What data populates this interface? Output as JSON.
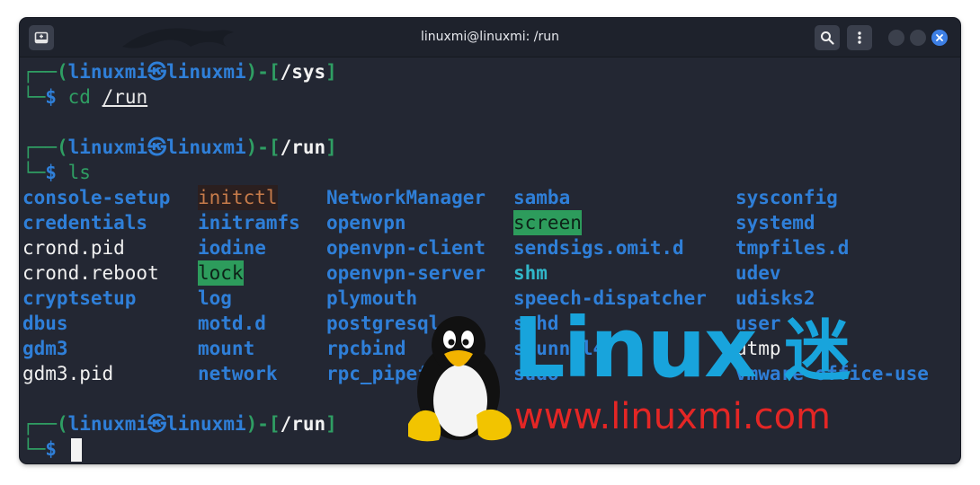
{
  "window": {
    "title": "linuxmi@linuxmi: /run",
    "colors": {
      "background": "#232733",
      "titlebar": "#1e222c",
      "close": "#3d7fe4"
    },
    "icons": [
      "new-tab-icon",
      "search-icon",
      "kebab-menu-icon",
      "minimize-icon",
      "maximize-icon",
      "close-icon"
    ]
  },
  "terminal": {
    "prompts": [
      {
        "corner": "┌──",
        "open": "(",
        "user": "linuxmi",
        "at": "㉿",
        "host": "linuxmi",
        "mid": ")-[",
        "path": "/sys",
        "close": "]",
        "bottom": "└─",
        "dollar": "$",
        "cmd": "cd",
        "arg": "/run"
      },
      {
        "corner": "┌──",
        "open": "(",
        "user": "linuxmi",
        "at": "㉿",
        "host": "linuxmi",
        "mid": ")-[",
        "path": "/run",
        "close": "]",
        "bottom": "└─",
        "dollar": "$",
        "cmd": "ls",
        "arg": ""
      },
      {
        "corner": "┌──",
        "open": "(",
        "user": "linuxmi",
        "at": "㉿",
        "host": "linuxmi",
        "mid": ")-[",
        "path": "/run",
        "close": "]",
        "bottom": "└─",
        "dollar": "$",
        "cmd": "",
        "arg": ""
      }
    ],
    "ls_columns": [
      [
        {
          "name": "console-setup",
          "kind": "dir"
        },
        {
          "name": "credentials",
          "kind": "dir"
        },
        {
          "name": "crond.pid",
          "kind": "file"
        },
        {
          "name": "crond.reboot",
          "kind": "file"
        },
        {
          "name": "cryptsetup",
          "kind": "dir"
        },
        {
          "name": "dbus",
          "kind": "dir"
        },
        {
          "name": "gdm3",
          "kind": "dir"
        },
        {
          "name": "gdm3.pid",
          "kind": "file"
        }
      ],
      [
        {
          "name": "initctl",
          "kind": "fifo"
        },
        {
          "name": "initramfs",
          "kind": "dir"
        },
        {
          "name": "iodine",
          "kind": "dir"
        },
        {
          "name": "lock",
          "kind": "sticky"
        },
        {
          "name": "log",
          "kind": "dir"
        },
        {
          "name": "motd.d",
          "kind": "dir"
        },
        {
          "name": "mount",
          "kind": "dir"
        },
        {
          "name": "network",
          "kind": "dir"
        }
      ],
      [
        {
          "name": "NetworkManager",
          "kind": "dir"
        },
        {
          "name": "openvpn",
          "kind": "dir"
        },
        {
          "name": "openvpn-client",
          "kind": "dir"
        },
        {
          "name": "openvpn-server",
          "kind": "dir"
        },
        {
          "name": "plymouth",
          "kind": "dir"
        },
        {
          "name": "postgresql",
          "kind": "dir"
        },
        {
          "name": "rpcbind",
          "kind": "dir"
        },
        {
          "name": "rpc_pipefs",
          "kind": "dir"
        }
      ],
      [
        {
          "name": "samba",
          "kind": "dir"
        },
        {
          "name": "screen",
          "kind": "sticky"
        },
        {
          "name": "sendsigs.omit.d",
          "kind": "dir"
        },
        {
          "name": "shm",
          "kind": "cyan"
        },
        {
          "name": "speech-dispatcher",
          "kind": "dir"
        },
        {
          "name": "sshd",
          "kind": "dir"
        },
        {
          "name": "stunnel4",
          "kind": "dir"
        },
        {
          "name": "sudo",
          "kind": "dir"
        }
      ],
      [
        {
          "name": "sysconfig",
          "kind": "dir"
        },
        {
          "name": "systemd",
          "kind": "dir"
        },
        {
          "name": "tmpfiles.d",
          "kind": "dir"
        },
        {
          "name": "udev",
          "kind": "dir"
        },
        {
          "name": "udisks2",
          "kind": "dir"
        },
        {
          "name": "user",
          "kind": "dir"
        },
        {
          "name": "utmp",
          "kind": "file"
        },
        {
          "name": "vmware-office-use",
          "kind": "dir"
        }
      ]
    ]
  },
  "watermark": {
    "logo": "Linux",
    "logo_cn": "迷",
    "url": "www.linuxmi.com",
    "colors": {
      "logo": "#18a4dc",
      "url": "#e42625"
    }
  }
}
